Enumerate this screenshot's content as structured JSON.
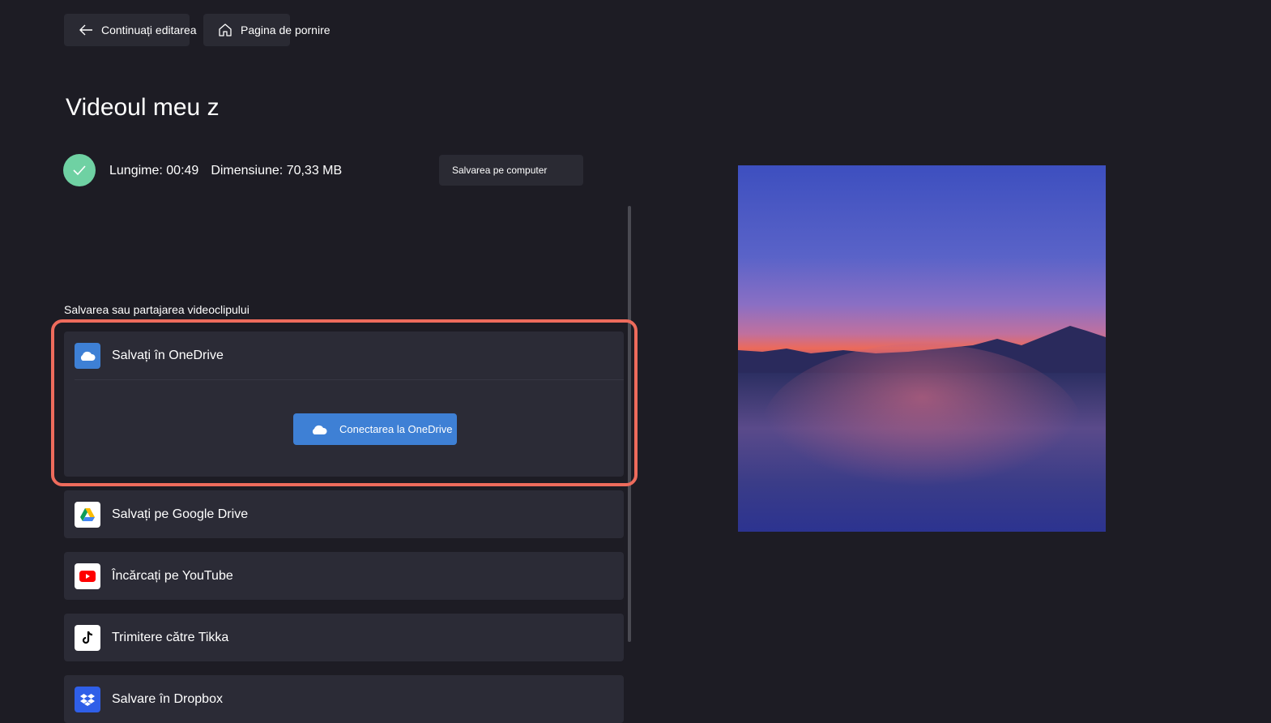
{
  "topbar": {
    "back_label": "Continuați editarea",
    "home_label": "Pagina de pornire"
  },
  "video": {
    "title": "Videoul meu z",
    "length": "Lungime: 00:49",
    "size": "Dimensiune: 70,33 MB",
    "save_to_computer_label": "Salvarea pe computer"
  },
  "share": {
    "section_label": "Salvarea sau partajarea videoclipului",
    "onedrive": {
      "label": "Salvați în OneDrive",
      "connect_label": "Conectarea la OneDrive",
      "icon": "onedrive-icon"
    },
    "google_drive": {
      "label": "Salvați pe Google Drive",
      "icon": "google-drive-icon"
    },
    "youtube": {
      "label": "Încărcați pe YouTube",
      "icon": "youtube-icon"
    },
    "tikka": {
      "label": "Trimitere către Tikka",
      "icon": "tiktok-icon"
    },
    "dropbox": {
      "label": "Salvare în Dropbox",
      "icon": "dropbox-icon"
    }
  },
  "colors": {
    "background": "#1d1c24",
    "card": "#2b2b36",
    "accent": "#3e80d5",
    "success": "#6fd1a3",
    "highlight": "#ee6b5c"
  }
}
